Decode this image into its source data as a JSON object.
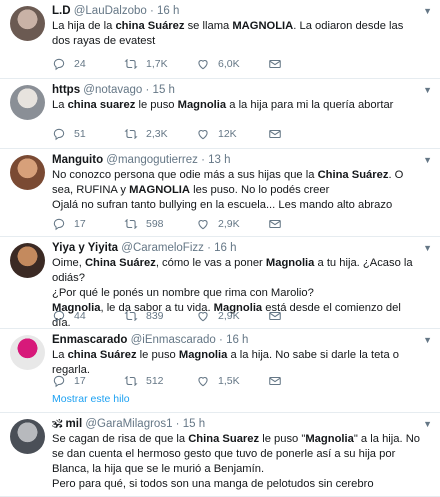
{
  "tweets": [
    {
      "name": "L.D",
      "handle": "@LauDalzobo",
      "time": "16 h",
      "text": [
        {
          "t": "La hija de la "
        },
        {
          "t": "china Suárez",
          "b": true
        },
        {
          "t": " se llama "
        },
        {
          "t": "MAGNOLIA",
          "b": true
        },
        {
          "t": ". La odiaron desde las dos rayas de evatest"
        }
      ],
      "replies": "24",
      "retweets": "1,7K",
      "likes": "6,0K",
      "avatar_colors": [
        "#6b5a52",
        "#c9b2a6"
      ]
    },
    {
      "name": "https",
      "handle": "@notavago",
      "time": "15 h",
      "text": [
        {
          "t": "La "
        },
        {
          "t": "china suarez",
          "b": true
        },
        {
          "t": " le puso "
        },
        {
          "t": "Magnolia",
          "b": true
        },
        {
          "t": " a la hija para mi la quería abortar"
        }
      ],
      "replies": "51",
      "retweets": "2,3K",
      "likes": "12K",
      "avatar_colors": [
        "#8a8f96",
        "#e7e3de"
      ]
    },
    {
      "name": "Manguito",
      "handle": "@mangogutierrez",
      "time": "13 h",
      "text": [
        {
          "t": "No conozco persona que odie más a sus hijas que la "
        },
        {
          "t": "China Suárez",
          "b": true
        },
        {
          "t": ". O sea, RUFINA y "
        },
        {
          "t": "MAGNOLIA",
          "b": true
        },
        {
          "t": " les puso. No lo podés creer\nOjalá no sufran tanto bullying en la escuela... Les mando alto abrazo"
        }
      ],
      "replies": "17",
      "retweets": "598",
      "likes": "2,9K",
      "avatar_colors": [
        "#7a4a33",
        "#d7a07a"
      ]
    },
    {
      "name": "Yiya y Yiyita",
      "handle": "@CarameloFizz",
      "time": "16 h",
      "text": [
        {
          "t": "Oime, "
        },
        {
          "t": "China Suárez",
          "b": true
        },
        {
          "t": ", cómo le vas a poner "
        },
        {
          "t": "Magnolia",
          "b": true
        },
        {
          "t": " a tu hija. ¿Acaso la odiás?\n¿Por qué le ponés un nombre que rima con Marolio?\n"
        },
        {
          "t": "Magnolia",
          "b": true
        },
        {
          "t": ", le da sabor a tu vida. "
        },
        {
          "t": "Magnolia",
          "b": true
        },
        {
          "t": " está desde el comienzo del día."
        }
      ],
      "replies": "44",
      "retweets": "839",
      "likes": "2,9K",
      "avatar_colors": [
        "#3b2a24",
        "#c48a5e"
      ]
    },
    {
      "name": "Enmascarado",
      "handle": "@iEnmascarado",
      "time": "16 h",
      "text": [
        {
          "t": "La "
        },
        {
          "t": "china Suárez",
          "b": true
        },
        {
          "t": " le puso "
        },
        {
          "t": "Magnolia",
          "b": true
        },
        {
          "t": " a la hija. No sabe si darle la teta o regarla."
        }
      ],
      "replies": "17",
      "retweets": "512",
      "likes": "1,5K",
      "avatar_colors": [
        "#e8e8e8",
        "#d7197a"
      ]
    },
    {
      "name": "🕉 mil",
      "handle": "@GaraMilagros1",
      "time": "15 h",
      "text": [
        {
          "t": "Se cagan de risa de que la "
        },
        {
          "t": "China Suarez",
          "b": true
        },
        {
          "t": " le puso \""
        },
        {
          "t": "Magnolia",
          "b": true
        },
        {
          "t": "\" a la hija. No se dan cuenta el hermoso gesto que tuvo de ponerle así a su hija por Blanca, la hija que se le murió a Benjamín.\nPero para qué, si todos son una manga de pelotudos sin cerebro"
        }
      ],
      "avatar_colors": [
        "#4a4f57",
        "#b7b9bd"
      ]
    }
  ],
  "show_thread_label": "Mostrar este hilo",
  "colors": {
    "muted": "#657786",
    "link": "#1da1f2",
    "border": "#e6ecf0"
  }
}
